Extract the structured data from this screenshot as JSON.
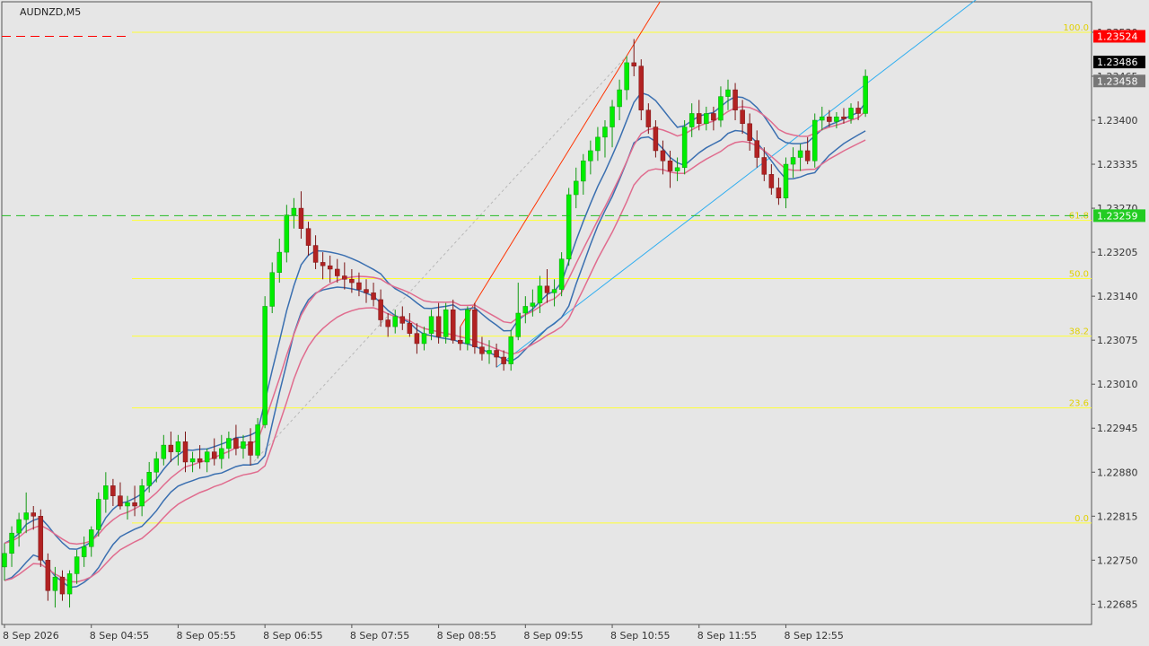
{
  "chart_data": {
    "type": "candlestick",
    "title": "AUDNZD,M5",
    "ylim": [
      1.22655,
      1.23575
    ],
    "y_ticks": [
      1.22685,
      1.2275,
      1.22815,
      1.2288,
      1.22945,
      1.2301,
      1.23075,
      1.2314,
      1.23205,
      1.2327,
      1.23335,
      1.234,
      1.23465,
      1.2353
    ],
    "x_ticks": [
      {
        "index": 0,
        "label": "8 Sep 2026"
      },
      {
        "index": 12,
        "label": "8 Sep 04:55"
      },
      {
        "index": 24,
        "label": "8 Sep 05:55"
      },
      {
        "index": 36,
        "label": "8 Sep 06:55"
      },
      {
        "index": 48,
        "label": "8 Sep 07:55"
      },
      {
        "index": 60,
        "label": "8 Sep 08:55"
      },
      {
        "index": 72,
        "label": "8 Sep 09:55"
      },
      {
        "index": 84,
        "label": "8 Sep 10:55"
      },
      {
        "index": 96,
        "label": "8 Sep 11:55"
      },
      {
        "index": 108,
        "label": "8 Sep 12:55"
      }
    ],
    "candles": [
      {
        "o": 1.2274,
        "h": 1.22775,
        "l": 1.2272,
        "c": 1.2276
      },
      {
        "o": 1.2276,
        "h": 1.228,
        "l": 1.2274,
        "c": 1.2279
      },
      {
        "o": 1.2279,
        "h": 1.2282,
        "l": 1.2277,
        "c": 1.2281
      },
      {
        "o": 1.2281,
        "h": 1.2285,
        "l": 1.2279,
        "c": 1.2282
      },
      {
        "o": 1.2282,
        "h": 1.2283,
        "l": 1.22795,
        "c": 1.22815
      },
      {
        "o": 1.22815,
        "h": 1.22825,
        "l": 1.2274,
        "c": 1.2275
      },
      {
        "o": 1.2275,
        "h": 1.2276,
        "l": 1.2269,
        "c": 1.22705
      },
      {
        "o": 1.22705,
        "h": 1.2274,
        "l": 1.2268,
        "c": 1.22725
      },
      {
        "o": 1.22725,
        "h": 1.22735,
        "l": 1.2269,
        "c": 1.227
      },
      {
        "o": 1.227,
        "h": 1.22735,
        "l": 1.2268,
        "c": 1.2273
      },
      {
        "o": 1.2273,
        "h": 1.22765,
        "l": 1.22715,
        "c": 1.22755
      },
      {
        "o": 1.22755,
        "h": 1.22785,
        "l": 1.2274,
        "c": 1.2277
      },
      {
        "o": 1.2277,
        "h": 1.228,
        "l": 1.22755,
        "c": 1.22795
      },
      {
        "o": 1.22795,
        "h": 1.2285,
        "l": 1.22785,
        "c": 1.2284
      },
      {
        "o": 1.2284,
        "h": 1.2288,
        "l": 1.2282,
        "c": 1.2286
      },
      {
        "o": 1.2286,
        "h": 1.2287,
        "l": 1.2283,
        "c": 1.22845
      },
      {
        "o": 1.22845,
        "h": 1.22865,
        "l": 1.22825,
        "c": 1.2283
      },
      {
        "o": 1.2283,
        "h": 1.22845,
        "l": 1.2281,
        "c": 1.22835
      },
      {
        "o": 1.22835,
        "h": 1.2286,
        "l": 1.22815,
        "c": 1.2283
      },
      {
        "o": 1.2283,
        "h": 1.2287,
        "l": 1.22815,
        "c": 1.2286
      },
      {
        "o": 1.2286,
        "h": 1.22895,
        "l": 1.2285,
        "c": 1.2288
      },
      {
        "o": 1.2288,
        "h": 1.2291,
        "l": 1.22865,
        "c": 1.229
      },
      {
        "o": 1.229,
        "h": 1.22935,
        "l": 1.2289,
        "c": 1.2292
      },
      {
        "o": 1.2292,
        "h": 1.2294,
        "l": 1.22895,
        "c": 1.2291
      },
      {
        "o": 1.2291,
        "h": 1.22935,
        "l": 1.2289,
        "c": 1.22925
      },
      {
        "o": 1.22925,
        "h": 1.2294,
        "l": 1.2288,
        "c": 1.22895
      },
      {
        "o": 1.22895,
        "h": 1.2291,
        "l": 1.2288,
        "c": 1.229
      },
      {
        "o": 1.229,
        "h": 1.2292,
        "l": 1.22885,
        "c": 1.22895
      },
      {
        "o": 1.22895,
        "h": 1.22915,
        "l": 1.2288,
        "c": 1.2291
      },
      {
        "o": 1.2291,
        "h": 1.2293,
        "l": 1.2289,
        "c": 1.229
      },
      {
        "o": 1.229,
        "h": 1.22935,
        "l": 1.22885,
        "c": 1.22915
      },
      {
        "o": 1.22915,
        "h": 1.2294,
        "l": 1.229,
        "c": 1.2293
      },
      {
        "o": 1.2293,
        "h": 1.2295,
        "l": 1.22905,
        "c": 1.22915
      },
      {
        "o": 1.22915,
        "h": 1.22935,
        "l": 1.229,
        "c": 1.22925
      },
      {
        "o": 1.22925,
        "h": 1.22945,
        "l": 1.2289,
        "c": 1.22905
      },
      {
        "o": 1.22905,
        "h": 1.2296,
        "l": 1.229,
        "c": 1.2295
      },
      {
        "o": 1.2295,
        "h": 1.2314,
        "l": 1.22945,
        "c": 1.23125
      },
      {
        "o": 1.23125,
        "h": 1.2319,
        "l": 1.23115,
        "c": 1.23175
      },
      {
        "o": 1.23175,
        "h": 1.23225,
        "l": 1.2316,
        "c": 1.23205
      },
      {
        "o": 1.23205,
        "h": 1.23275,
        "l": 1.2319,
        "c": 1.2326
      },
      {
        "o": 1.2326,
        "h": 1.23285,
        "l": 1.2324,
        "c": 1.2327
      },
      {
        "o": 1.2327,
        "h": 1.23295,
        "l": 1.23225,
        "c": 1.2324
      },
      {
        "o": 1.2324,
        "h": 1.2325,
        "l": 1.232,
        "c": 1.23215
      },
      {
        "o": 1.23215,
        "h": 1.2323,
        "l": 1.2318,
        "c": 1.2319
      },
      {
        "o": 1.2319,
        "h": 1.23205,
        "l": 1.23165,
        "c": 1.23185
      },
      {
        "o": 1.23185,
        "h": 1.232,
        "l": 1.2316,
        "c": 1.2318
      },
      {
        "o": 1.2318,
        "h": 1.23195,
        "l": 1.2316,
        "c": 1.2317
      },
      {
        "o": 1.2317,
        "h": 1.2319,
        "l": 1.2315,
        "c": 1.23165
      },
      {
        "o": 1.23165,
        "h": 1.2318,
        "l": 1.23145,
        "c": 1.2316
      },
      {
        "o": 1.2316,
        "h": 1.23175,
        "l": 1.2314,
        "c": 1.2315
      },
      {
        "o": 1.2315,
        "h": 1.23165,
        "l": 1.2313,
        "c": 1.23145
      },
      {
        "o": 1.23145,
        "h": 1.2316,
        "l": 1.23125,
        "c": 1.23135
      },
      {
        "o": 1.23135,
        "h": 1.2315,
        "l": 1.23095,
        "c": 1.23105
      },
      {
        "o": 1.23105,
        "h": 1.23115,
        "l": 1.2308,
        "c": 1.23095
      },
      {
        "o": 1.23095,
        "h": 1.2312,
        "l": 1.23085,
        "c": 1.2311
      },
      {
        "o": 1.2311,
        "h": 1.23125,
        "l": 1.2309,
        "c": 1.231
      },
      {
        "o": 1.231,
        "h": 1.23115,
        "l": 1.2308,
        "c": 1.23085
      },
      {
        "o": 1.23085,
        "h": 1.231,
        "l": 1.23055,
        "c": 1.2307
      },
      {
        "o": 1.2307,
        "h": 1.23095,
        "l": 1.2306,
        "c": 1.23085
      },
      {
        "o": 1.23085,
        "h": 1.2312,
        "l": 1.23075,
        "c": 1.2311
      },
      {
        "o": 1.2311,
        "h": 1.2313,
        "l": 1.2307,
        "c": 1.2308
      },
      {
        "o": 1.2308,
        "h": 1.2313,
        "l": 1.2307,
        "c": 1.2312
      },
      {
        "o": 1.2312,
        "h": 1.23135,
        "l": 1.2307,
        "c": 1.23075
      },
      {
        "o": 1.23075,
        "h": 1.23095,
        "l": 1.2306,
        "c": 1.2307
      },
      {
        "o": 1.2307,
        "h": 1.23125,
        "l": 1.2306,
        "c": 1.2312
      },
      {
        "o": 1.2312,
        "h": 1.2313,
        "l": 1.23055,
        "c": 1.23065
      },
      {
        "o": 1.23065,
        "h": 1.2308,
        "l": 1.23045,
        "c": 1.23055
      },
      {
        "o": 1.23055,
        "h": 1.23075,
        "l": 1.2304,
        "c": 1.2306
      },
      {
        "o": 1.2306,
        "h": 1.2307,
        "l": 1.23035,
        "c": 1.2305
      },
      {
        "o": 1.2305,
        "h": 1.2306,
        "l": 1.2303,
        "c": 1.2304
      },
      {
        "o": 1.2304,
        "h": 1.2309,
        "l": 1.2303,
        "c": 1.2308
      },
      {
        "o": 1.2308,
        "h": 1.2316,
        "l": 1.23075,
        "c": 1.23115
      },
      {
        "o": 1.23115,
        "h": 1.2314,
        "l": 1.231,
        "c": 1.23125
      },
      {
        "o": 1.23125,
        "h": 1.2315,
        "l": 1.2311,
        "c": 1.2313
      },
      {
        "o": 1.2313,
        "h": 1.2317,
        "l": 1.23115,
        "c": 1.23155
      },
      {
        "o": 1.23155,
        "h": 1.2318,
        "l": 1.2313,
        "c": 1.23145
      },
      {
        "o": 1.23145,
        "h": 1.23165,
        "l": 1.23125,
        "c": 1.2315
      },
      {
        "o": 1.2315,
        "h": 1.23205,
        "l": 1.2314,
        "c": 1.23195
      },
      {
        "o": 1.23195,
        "h": 1.233,
        "l": 1.23185,
        "c": 1.2329
      },
      {
        "o": 1.2329,
        "h": 1.2333,
        "l": 1.2327,
        "c": 1.2331
      },
      {
        "o": 1.2331,
        "h": 1.2335,
        "l": 1.2329,
        "c": 1.2334
      },
      {
        "o": 1.2334,
        "h": 1.2337,
        "l": 1.2332,
        "c": 1.23355
      },
      {
        "o": 1.23355,
        "h": 1.2339,
        "l": 1.2334,
        "c": 1.23375
      },
      {
        "o": 1.23375,
        "h": 1.234,
        "l": 1.23345,
        "c": 1.2339
      },
      {
        "o": 1.2339,
        "h": 1.2343,
        "l": 1.2336,
        "c": 1.2342
      },
      {
        "o": 1.2342,
        "h": 1.2346,
        "l": 1.234,
        "c": 1.23445
      },
      {
        "o": 1.23445,
        "h": 1.23495,
        "l": 1.2343,
        "c": 1.23485
      },
      {
        "o": 1.23485,
        "h": 1.2352,
        "l": 1.23465,
        "c": 1.2348
      },
      {
        "o": 1.2348,
        "h": 1.2349,
        "l": 1.234,
        "c": 1.23415
      },
      {
        "o": 1.23415,
        "h": 1.23425,
        "l": 1.2338,
        "c": 1.2339
      },
      {
        "o": 1.2339,
        "h": 1.234,
        "l": 1.23345,
        "c": 1.23355
      },
      {
        "o": 1.23355,
        "h": 1.2337,
        "l": 1.2332,
        "c": 1.2334
      },
      {
        "o": 1.2334,
        "h": 1.23355,
        "l": 1.233,
        "c": 1.23325
      },
      {
        "o": 1.23325,
        "h": 1.23345,
        "l": 1.2331,
        "c": 1.2333
      },
      {
        "o": 1.2333,
        "h": 1.234,
        "l": 1.2332,
        "c": 1.2339
      },
      {
        "o": 1.2339,
        "h": 1.23425,
        "l": 1.23375,
        "c": 1.2341
      },
      {
        "o": 1.2341,
        "h": 1.2343,
        "l": 1.23385,
        "c": 1.23395
      },
      {
        "o": 1.23395,
        "h": 1.2342,
        "l": 1.23385,
        "c": 1.2341
      },
      {
        "o": 1.2341,
        "h": 1.2342,
        "l": 1.23385,
        "c": 1.234
      },
      {
        "o": 1.234,
        "h": 1.2345,
        "l": 1.2339,
        "c": 1.23435
      },
      {
        "o": 1.23435,
        "h": 1.2346,
        "l": 1.23415,
        "c": 1.23445
      },
      {
        "o": 1.23445,
        "h": 1.23455,
        "l": 1.234,
        "c": 1.23415
      },
      {
        "o": 1.23415,
        "h": 1.2343,
        "l": 1.2338,
        "c": 1.23395
      },
      {
        "o": 1.23395,
        "h": 1.2341,
        "l": 1.23355,
        "c": 1.2337
      },
      {
        "o": 1.2337,
        "h": 1.23385,
        "l": 1.2333,
        "c": 1.23345
      },
      {
        "o": 1.23345,
        "h": 1.2336,
        "l": 1.2331,
        "c": 1.2332
      },
      {
        "o": 1.2332,
        "h": 1.23335,
        "l": 1.2329,
        "c": 1.233
      },
      {
        "o": 1.233,
        "h": 1.23315,
        "l": 1.23275,
        "c": 1.23285
      },
      {
        "o": 1.23285,
        "h": 1.23345,
        "l": 1.2327,
        "c": 1.23335
      },
      {
        "o": 1.23335,
        "h": 1.2336,
        "l": 1.23315,
        "c": 1.23345
      },
      {
        "o": 1.23345,
        "h": 1.23365,
        "l": 1.23325,
        "c": 1.23355
      },
      {
        "o": 1.23355,
        "h": 1.23375,
        "l": 1.23335,
        "c": 1.2334
      },
      {
        "o": 1.2334,
        "h": 1.2341,
        "l": 1.2333,
        "c": 1.234
      },
      {
        "o": 1.234,
        "h": 1.2342,
        "l": 1.23385,
        "c": 1.23405
      },
      {
        "o": 1.23405,
        "h": 1.23415,
        "l": 1.2339,
        "c": 1.23398
      },
      {
        "o": 1.23398,
        "h": 1.23412,
        "l": 1.23388,
        "c": 1.23405
      },
      {
        "o": 1.23405,
        "h": 1.23418,
        "l": 1.23395,
        "c": 1.23402
      },
      {
        "o": 1.23402,
        "h": 1.23425,
        "l": 1.23395,
        "c": 1.23418
      },
      {
        "o": 1.23418,
        "h": 1.23428,
        "l": 1.234,
        "c": 1.2341
      },
      {
        "o": 1.2341,
        "h": 1.23475,
        "l": 1.23405,
        "c": 1.23465
      }
    ],
    "fib_levels": [
      {
        "label": "100.0",
        "price": 1.2353
      },
      {
        "label": "61.8",
        "price": 1.23252
      },
      {
        "label": "50.0",
        "price": 1.23166
      },
      {
        "label": "38.2",
        "price": 1.23081
      },
      {
        "label": "23.6",
        "price": 1.22975
      },
      {
        "label": "0.0",
        "price": 1.22805
      }
    ],
    "price_tags": [
      {
        "price": 1.23524,
        "label": "1.23524",
        "bg": "#ff0000",
        "fg": "#ffffff"
      },
      {
        "price": 1.23486,
        "label": "1.23486",
        "bg": "#000000",
        "fg": "#ffffff"
      },
      {
        "price": 1.23458,
        "label": "1.23458",
        "bg": "#777777",
        "fg": "#ffffff"
      },
      {
        "price": 1.23259,
        "label": "1.23259",
        "bg": "#22cc22",
        "fg": "#ffffff"
      }
    ],
    "colors": {
      "background": "#e6e6e6",
      "bull_candle": "#00ee00",
      "bear_candle": "#b22222",
      "ma_blue": "#3a6fb0",
      "ma_pink": "#e06c8e",
      "fib": "#ffff33",
      "trend_blue": "#30aef0",
      "trend_red": "#ff3300",
      "ask_line": "#ff0000",
      "bid_line": "#22bb22"
    }
  }
}
